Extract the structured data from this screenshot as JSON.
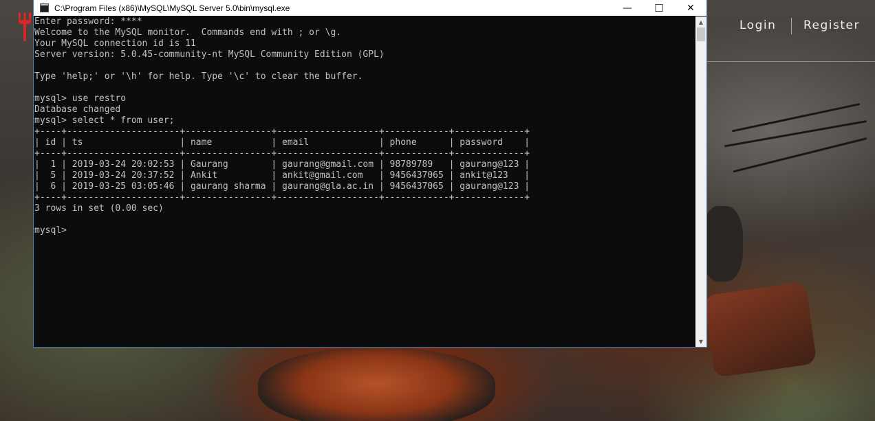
{
  "website": {
    "nav": {
      "login_label": "Login",
      "register_label": "Register"
    },
    "logo_icon": "fork-spoon-icon",
    "accent_color": "#d62828"
  },
  "console_window": {
    "title": "C:\\Program Files (x86)\\MySQL\\MySQL Server 5.0\\bin\\mysql.exe",
    "buttons": {
      "minimize": "—",
      "maximize": "☐",
      "close": "✕"
    },
    "lines": [
      "Enter password: ****",
      "Welcome to the MySQL monitor.  Commands end with ; or \\g.",
      "Your MySQL connection id is 11",
      "Server version: 5.0.45-community-nt MySQL Community Edition (GPL)",
      "",
      "Type 'help;' or '\\h' for help. Type '\\c' to clear the buffer.",
      "",
      "mysql> use restro",
      "Database changed",
      "mysql> select * from user;",
      "+----+---------------------+----------------+-------------------+------------+-------------+",
      "| id | ts                  | name           | email             | phone      | password    |",
      "+----+---------------------+----------------+-------------------+------------+-------------+",
      "|  1 | 2019-03-24 20:02:53 | Gaurang        | gaurang@gmail.com | 98789789   | gaurang@123 |",
      "|  5 | 2019-03-24 20:37:52 | Ankit          | ankit@gmail.com   | 9456437065 | ankit@123   |",
      "|  6 | 2019-03-25 03:05:46 | gaurang sharma | gaurang@gla.ac.in | 9456437065 | gaurang@123 |",
      "+----+---------------------+----------------+-------------------+------------+-------------+",
      "3 rows in set (0.00 sec)",
      "",
      "mysql> "
    ],
    "text_color": "#c0c0c0",
    "background_color": "#0c0c0c",
    "scrollbar": {
      "up_arrow": "▲",
      "down_arrow": "▼"
    }
  }
}
